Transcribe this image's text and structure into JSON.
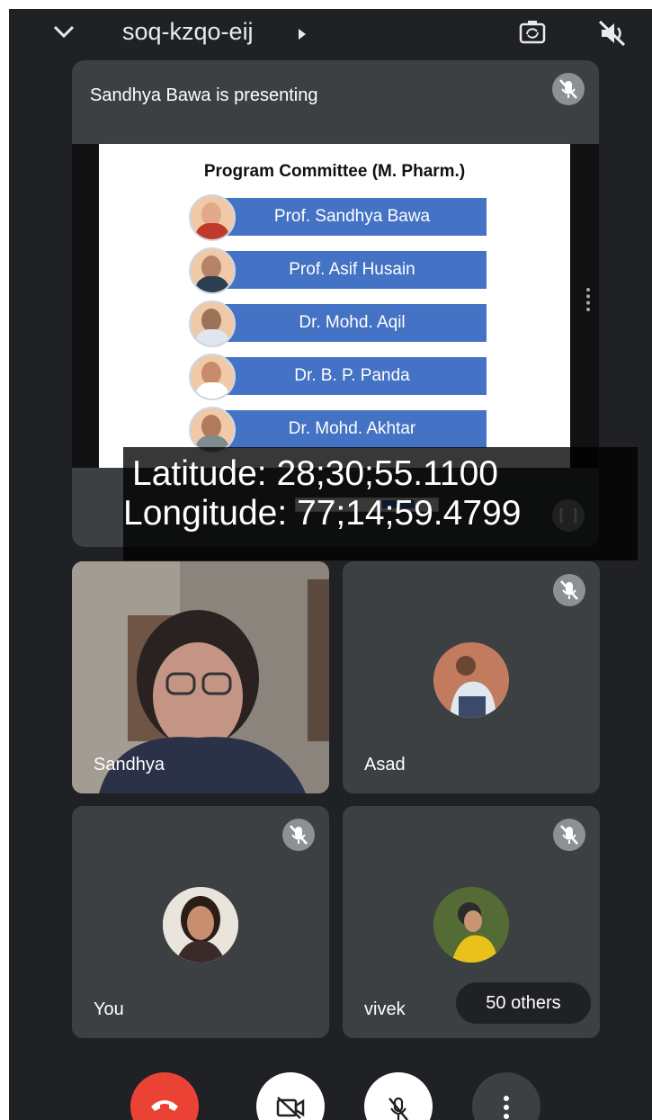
{
  "topbar": {
    "meeting_code": "soq-kzqo-eij",
    "icons": [
      "chevron-down-icon",
      "camera-switch-icon",
      "speaker-off-icon"
    ]
  },
  "presentation": {
    "title": "Sandhya Bawa is presenting",
    "slide": {
      "heading": "Program Committee (M. Pharm.)",
      "members": [
        "Prof. Sandhya Bawa",
        "Prof. Asif Husain",
        "Dr. Mohd. Aqil",
        "Dr. B. P. Panda",
        "Dr. Mohd. Akhtar"
      ]
    }
  },
  "geotag": {
    "latitude": "Latitude: 28;30;55.1100",
    "longitude": "Longitude: 77;14;59.4799"
  },
  "participants": [
    {
      "name": "Sandhya",
      "muted": false
    },
    {
      "name": "Asad",
      "muted": true
    },
    {
      "name": "You",
      "muted": true
    },
    {
      "name": "vivek",
      "muted": true
    }
  ],
  "others_chip": "50 others",
  "controls": {
    "icons": [
      "end-call-icon",
      "camera-off-icon",
      "mic-off-icon",
      "more-options-icon"
    ],
    "end_call_color": "#ea4335"
  },
  "colors": {
    "background": "#202124",
    "tile": "#3c4043",
    "slide_bar": "#4472c4"
  }
}
